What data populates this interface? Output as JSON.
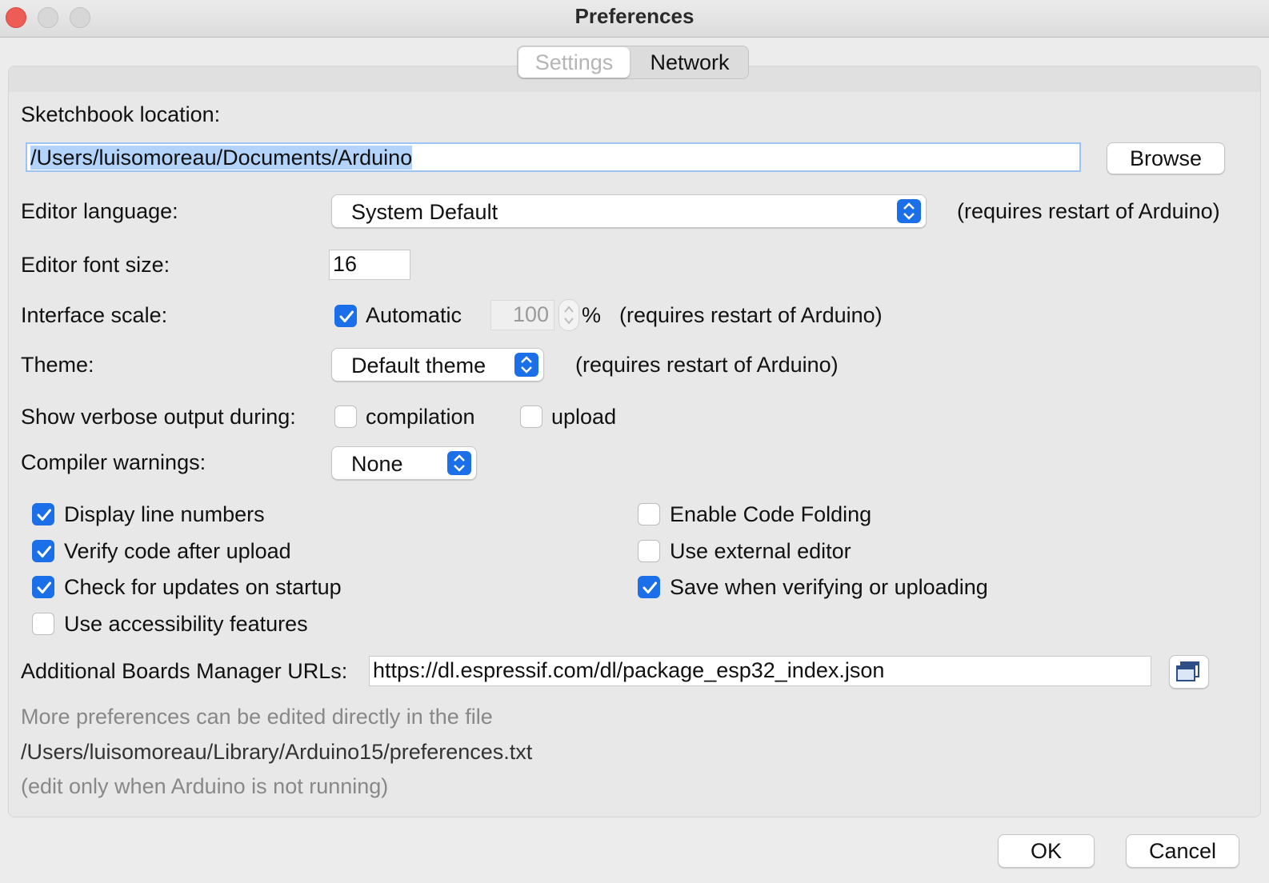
{
  "window": {
    "title": "Preferences"
  },
  "tabs": [
    {
      "label": "Settings",
      "selected": true
    },
    {
      "label": "Network",
      "selected": false
    }
  ],
  "sketchbook": {
    "label": "Sketchbook location:",
    "value": "/Users/luisomoreau/Documents/Arduino",
    "browse_label": "Browse"
  },
  "editor_language": {
    "label": "Editor language:",
    "value": "System Default",
    "note": "(requires restart of Arduino)"
  },
  "font_size": {
    "label": "Editor font size:",
    "value": "16"
  },
  "interface_scale": {
    "label": "Interface scale:",
    "automatic_label": "Automatic",
    "automatic_checked": true,
    "value": "100",
    "unit": "%",
    "note": "(requires restart of Arduino)"
  },
  "theme": {
    "label": "Theme:",
    "value": "Default theme",
    "note": "(requires restart of Arduino)"
  },
  "verbose": {
    "label": "Show verbose output during:",
    "compilation_label": "compilation",
    "compilation_checked": false,
    "upload_label": "upload",
    "upload_checked": false
  },
  "compiler_warnings": {
    "label": "Compiler warnings:",
    "value": "None"
  },
  "options_left": [
    {
      "label": "Display line numbers",
      "checked": true
    },
    {
      "label": "Verify code after upload",
      "checked": true
    },
    {
      "label": "Check for updates on startup",
      "checked": true
    },
    {
      "label": "Use accessibility features",
      "checked": false
    }
  ],
  "options_right": [
    {
      "label": "Enable Code Folding",
      "checked": false
    },
    {
      "label": "Use external editor",
      "checked": false
    },
    {
      "label": "Save when verifying or uploading",
      "checked": true
    }
  ],
  "boards_manager": {
    "label": "Additional Boards Manager URLs:",
    "value": "https://dl.espressif.com/dl/package_esp32_index.json",
    "icon": "open-window-icon"
  },
  "footer_notes": {
    "line1": "More preferences can be edited directly in the file",
    "line2": "/Users/luisomoreau/Library/Arduino15/preferences.txt",
    "line3": "(edit only when Arduino is not running)"
  },
  "buttons": {
    "ok": "OK",
    "cancel": "Cancel"
  },
  "colors": {
    "accent": "#1b6fe8",
    "close": "#ee5d55",
    "selection": "#b3d3fb"
  }
}
